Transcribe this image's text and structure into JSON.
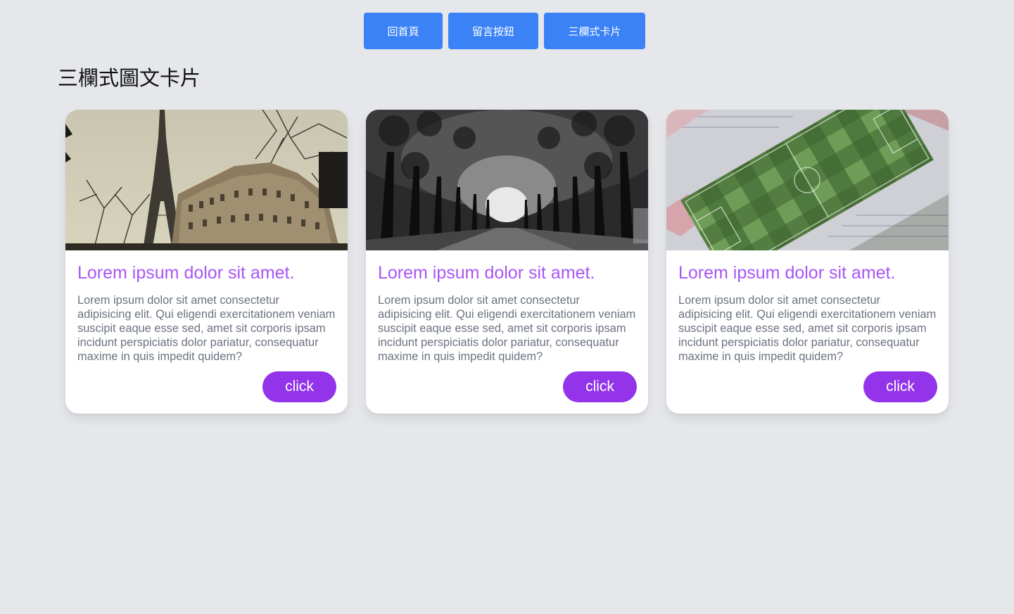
{
  "nav": {
    "buttons": [
      "回首頁",
      "留言按鈕",
      "三欄式卡片"
    ]
  },
  "page": {
    "title": "三欄式圖文卡片"
  },
  "cards": [
    {
      "image": "paris-eiffel-tower-photo",
      "title": "Lorem ipsum dolor sit amet.",
      "text": "Lorem ipsum dolor sit amet consectetur adipisicing elit. Qui eligendi exercitationem veniam suscipit eaque esse sed, amet sit corporis ipsam incidunt perspiciatis dolor pariatur, consequatur maxime in quis impedit quidem?",
      "button": "click"
    },
    {
      "image": "tree-tunnel-road-photo",
      "title": "Lorem ipsum dolor sit amet.",
      "text": "Lorem ipsum dolor sit amet consectetur adipisicing elit. Qui eligendi exercitationem veniam suscipit eaque esse sed, amet sit corporis ipsam incidunt perspiciatis dolor pariatur, consequatur maxime in quis impedit quidem?",
      "button": "click"
    },
    {
      "image": "football-stadium-aerial-photo",
      "title": "Lorem ipsum dolor sit amet.",
      "text": "Lorem ipsum dolor sit amet consectetur adipisicing elit. Qui eligendi exercitationem veniam suscipit eaque esse sed, amet sit corporis ipsam incidunt perspiciatis dolor pariatur, consequatur maxime in quis impedit quidem?",
      "button": "click"
    }
  ],
  "colors": {
    "background": "#e5e7eb",
    "nav_button": "#3b82f6",
    "card_title": "#a855f7",
    "card_button": "#9333ea",
    "card_text": "#6b7280"
  }
}
